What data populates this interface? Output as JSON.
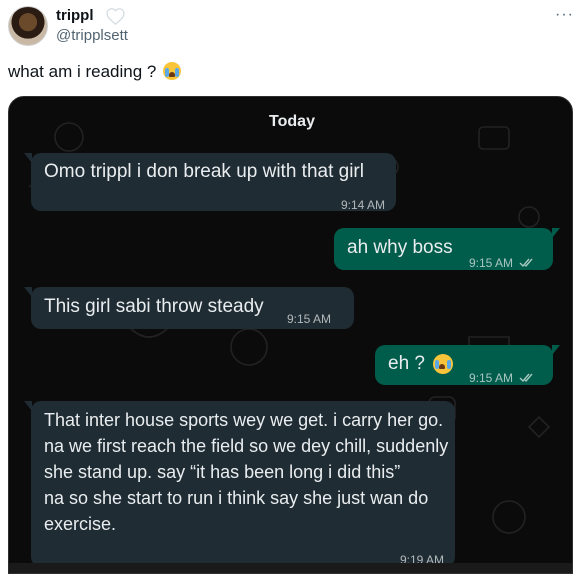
{
  "tweet": {
    "display_name": "trippl",
    "handle": "@tripplsett",
    "badge_icon": "white-heart-icon",
    "more_label": "···",
    "text": "what am i reading ?",
    "emoji_icon": "loudly-crying-face-icon"
  },
  "chat": {
    "date_chip": "Today",
    "messages": [
      {
        "dir": "in",
        "text": "Omo trippl i don break up with that girl",
        "time": "9:14 AM"
      },
      {
        "dir": "out",
        "text": "ah why boss",
        "time": "9:15 AM",
        "read_icon": "double-check-icon"
      },
      {
        "dir": "in",
        "text": "This girl sabi throw steady",
        "time": "9:15 AM"
      },
      {
        "dir": "out",
        "text": "eh ?",
        "time": "9:15 AM",
        "read_icon": "double-check-icon",
        "emoji_icon": "loudly-crying-face-icon"
      },
      {
        "dir": "in",
        "text": "That inter house sports wey we get. i carry her go. na we first reach the field so we dey chill, suddenly she stand up. say “it has been long i did this”\nna so she start to run i think say she just wan do exercise.",
        "time": "9:19 AM"
      }
    ],
    "colors": {
      "incoming_bubble": "#1f2c33",
      "outgoing_bubble": "#005c4b",
      "background": "#0b0b0b"
    }
  }
}
